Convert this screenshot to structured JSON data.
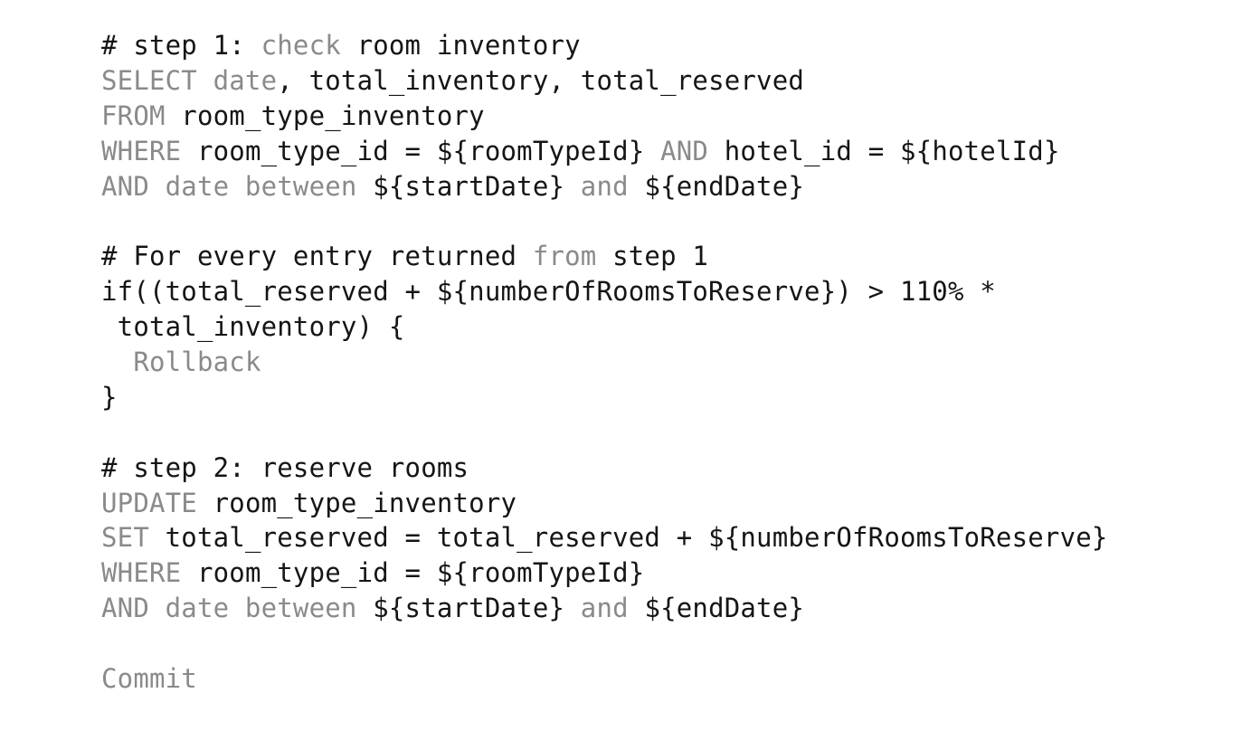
{
  "code": {
    "lines": [
      {
        "indent": "",
        "tokens": [
          {
            "t": "# step 1: ",
            "k": false
          },
          {
            "t": "check",
            "k": true
          },
          {
            "t": " room inventory",
            "k": false
          }
        ]
      },
      {
        "indent": "",
        "tokens": [
          {
            "t": "SELECT date",
            "k": true
          },
          {
            "t": ", total_inventory, total_reserved",
            "k": false
          }
        ]
      },
      {
        "indent": "",
        "tokens": [
          {
            "t": "FROM",
            "k": true
          },
          {
            "t": " room_type_inventory",
            "k": false
          }
        ]
      },
      {
        "indent": "",
        "tokens": [
          {
            "t": "WHERE",
            "k": true
          },
          {
            "t": " room_type_id = ${roomTypeId} ",
            "k": false
          },
          {
            "t": "AND",
            "k": true
          },
          {
            "t": " hotel_id = ${hotelId}",
            "k": false
          }
        ]
      },
      {
        "indent": "",
        "tokens": [
          {
            "t": "AND date between",
            "k": true
          },
          {
            "t": " ${startDate} ",
            "k": false
          },
          {
            "t": "and",
            "k": true
          },
          {
            "t": " ${endDate}",
            "k": false
          }
        ]
      },
      {
        "indent": "",
        "tokens": []
      },
      {
        "indent": "",
        "tokens": [
          {
            "t": "# For every entry returned ",
            "k": false
          },
          {
            "t": "from",
            "k": true
          },
          {
            "t": " step 1",
            "k": false
          }
        ]
      },
      {
        "indent": "",
        "tokens": [
          {
            "t": "if((total_reserved + ${numberOfRoomsToReserve}) > 110% *",
            "k": false
          }
        ]
      },
      {
        "indent": " ",
        "tokens": [
          {
            "t": "total_inventory) {",
            "k": false
          }
        ]
      },
      {
        "indent": "  ",
        "tokens": [
          {
            "t": "Rollback",
            "k": true
          }
        ]
      },
      {
        "indent": "",
        "tokens": [
          {
            "t": "}",
            "k": false
          }
        ]
      },
      {
        "indent": "",
        "tokens": []
      },
      {
        "indent": "",
        "tokens": [
          {
            "t": "# step 2: reserve rooms",
            "k": false
          }
        ]
      },
      {
        "indent": "",
        "tokens": [
          {
            "t": "UPDATE",
            "k": true
          },
          {
            "t": " room_type_inventory",
            "k": false
          }
        ]
      },
      {
        "indent": "",
        "tokens": [
          {
            "t": "SET",
            "k": true
          },
          {
            "t": " total_reserved = total_reserved + ${numberOfRoomsToReserve}",
            "k": false
          }
        ]
      },
      {
        "indent": "",
        "tokens": [
          {
            "t": "WHERE",
            "k": true
          },
          {
            "t": " room_type_id = ${roomTypeId}",
            "k": false
          }
        ]
      },
      {
        "indent": "",
        "tokens": [
          {
            "t": "AND date between",
            "k": true
          },
          {
            "t": " ${startDate} ",
            "k": false
          },
          {
            "t": "and",
            "k": true
          },
          {
            "t": " ${endDate}",
            "k": false
          }
        ]
      },
      {
        "indent": "",
        "tokens": []
      },
      {
        "indent": "",
        "tokens": [
          {
            "t": "Commit",
            "k": true
          }
        ]
      }
    ]
  },
  "colors": {
    "keyword": "#8a8a8a",
    "text": "#151515",
    "background": "#ffffff"
  }
}
